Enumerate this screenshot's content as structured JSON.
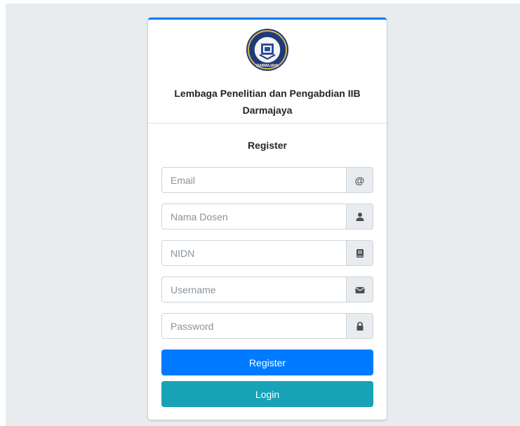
{
  "header": {
    "title": "Lembaga Penelitian dan Pengabdian IIB Darmajaya",
    "logo_icon": "darmajaya-seal-icon",
    "logo_text": "DARMAJAYA"
  },
  "form": {
    "title": "Register",
    "fields": [
      {
        "placeholder": "Email",
        "icon": "at-icon",
        "addon_text": "@"
      },
      {
        "placeholder": "Nama Dosen",
        "icon": "user-icon"
      },
      {
        "placeholder": "NIDN",
        "icon": "book-icon"
      },
      {
        "placeholder": "Username",
        "icon": "envelope-icon"
      },
      {
        "placeholder": "Password",
        "icon": "lock-icon"
      }
    ],
    "register_label": "Register",
    "login_label": "Login"
  },
  "colors": {
    "primary": "#007bff",
    "info": "#17a2b8",
    "background": "#e9ecef"
  }
}
